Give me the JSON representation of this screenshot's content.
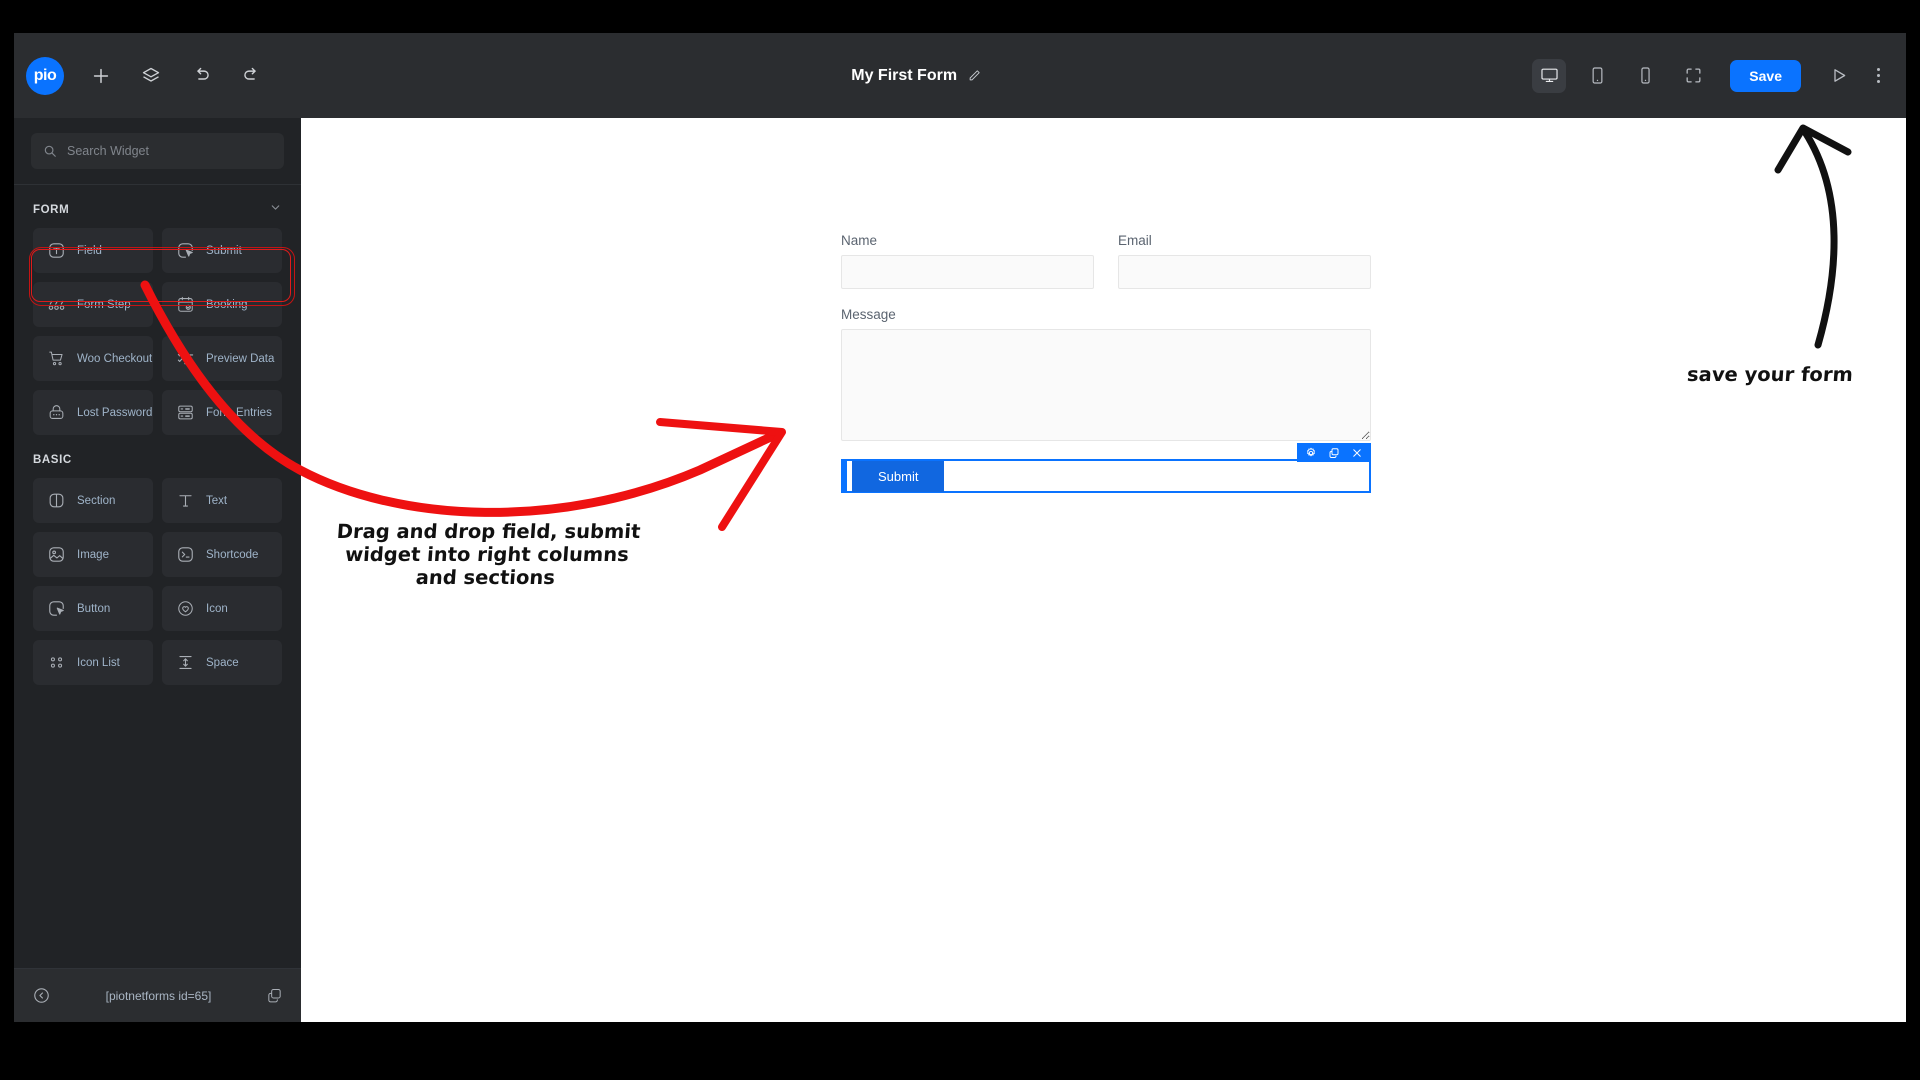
{
  "app": {
    "brand": "pio",
    "accent_color": "#0a73ff",
    "annotation_color": "#e01b1b"
  },
  "topbar": {
    "logo_label": "pio",
    "left_icons": [
      {
        "name": "add-icon",
        "label": "Add"
      },
      {
        "name": "layers-icon",
        "label": "Layers"
      },
      {
        "name": "undo-icon",
        "label": "Undo"
      },
      {
        "name": "redo-icon",
        "label": "Redo"
      }
    ],
    "form_title": "My First Form",
    "edit_title_label": "Rename",
    "view_modes": [
      {
        "name": "desktop-view",
        "label": "Desktop",
        "active": true
      },
      {
        "name": "tablet-view",
        "label": "Tablet",
        "active": false
      },
      {
        "name": "mobile-view",
        "label": "Mobile",
        "active": false
      },
      {
        "name": "fullscreen-view",
        "label": "Fullscreen",
        "active": false
      }
    ],
    "save_label": "Save",
    "preview_label": "Preview",
    "more_label": "More options"
  },
  "sidebar": {
    "search": {
      "placeholder": "Search Widget",
      "value": ""
    },
    "categories": [
      {
        "title": "FORM",
        "collapsed": false,
        "widgets": [
          {
            "label": "Field",
            "icon": "text-field-icon"
          },
          {
            "label": "Submit",
            "icon": "submit-cursor-icon"
          },
          {
            "label": "Form Step",
            "icon": "form-step-icon"
          },
          {
            "label": "Booking",
            "icon": "calendar-icon"
          },
          {
            "label": "Woo Checkout",
            "icon": "cart-icon"
          },
          {
            "label": "Preview Data",
            "icon": "checklist-icon"
          },
          {
            "label": "Lost Password",
            "icon": "lock-icon"
          },
          {
            "label": "Form Entries",
            "icon": "database-icon"
          }
        ]
      },
      {
        "title": "BASIC",
        "collapsed": false,
        "widgets": [
          {
            "label": "Section",
            "icon": "section-icon"
          },
          {
            "label": "Text",
            "icon": "text-icon"
          },
          {
            "label": "Image",
            "icon": "image-icon"
          },
          {
            "label": "Shortcode",
            "icon": "shortcode-icon"
          },
          {
            "label": "Button",
            "icon": "button-cursor-icon"
          },
          {
            "label": "Icon",
            "icon": "heart-icon"
          },
          {
            "label": "Icon List",
            "icon": "icon-list-icon"
          },
          {
            "label": "Space",
            "icon": "space-icon"
          }
        ]
      }
    ],
    "footer": {
      "collapse_label": "Collapse panel",
      "shortcode": "[piotnetforms id=65]",
      "copy_label": "Copy shortcode"
    }
  },
  "canvas": {
    "fields": [
      {
        "label": "Name",
        "value": "",
        "type": "input"
      },
      {
        "label": "Email",
        "value": "",
        "type": "input"
      },
      {
        "label": "Message",
        "value": "",
        "type": "textarea"
      }
    ],
    "submit": {
      "label": "Submit",
      "selected": true,
      "toolbar": [
        {
          "name": "settings-gear-icon",
          "label": "Edit"
        },
        {
          "name": "duplicate-icon",
          "label": "Duplicate"
        },
        {
          "name": "close-icon",
          "label": "Delete"
        }
      ]
    }
  },
  "annotations": [
    {
      "id": "drag-hint",
      "text": "Drag and drop field, submit widget into right columns and sections",
      "color": "#111111",
      "arrow_color": "#ee1111"
    },
    {
      "id": "save-hint",
      "text": "save your form",
      "color": "#111111",
      "arrow_color": "#111111"
    }
  ]
}
